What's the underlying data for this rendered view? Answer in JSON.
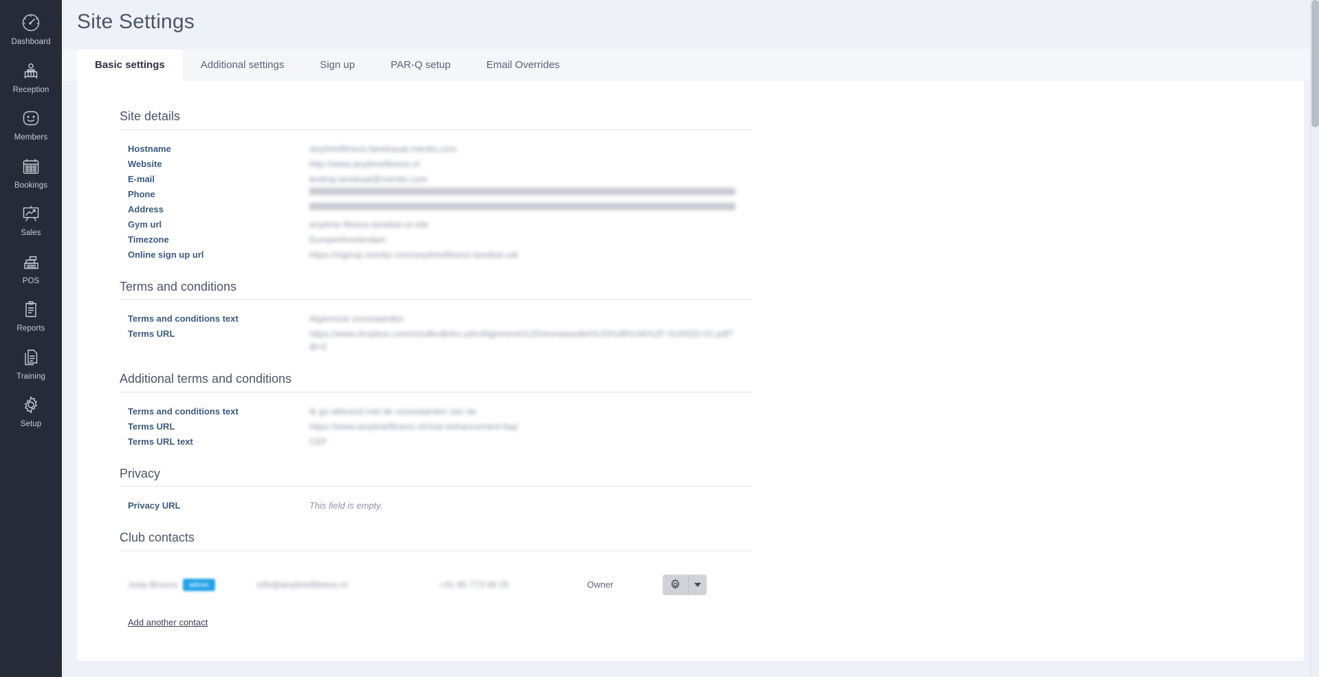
{
  "sidebar": {
    "items": [
      {
        "label": "Dashboard",
        "icon": "speedometer-icon"
      },
      {
        "label": "Reception",
        "icon": "reception-desk-icon"
      },
      {
        "label": "Members",
        "icon": "smiley-face-icon"
      },
      {
        "label": "Bookings",
        "icon": "calendar-icon"
      },
      {
        "label": "Sales",
        "icon": "presentation-chart-icon"
      },
      {
        "label": "POS",
        "icon": "cash-register-icon"
      },
      {
        "label": "Reports",
        "icon": "clipboard-icon"
      },
      {
        "label": "Training",
        "icon": "documents-icon"
      },
      {
        "label": "Setup",
        "icon": "gear-icon"
      }
    ]
  },
  "header": {
    "title": "Site Settings"
  },
  "tabs": [
    {
      "label": "Basic settings",
      "active": true
    },
    {
      "label": "Additional settings",
      "active": false
    },
    {
      "label": "Sign up",
      "active": false
    },
    {
      "label": "PAR-Q setup",
      "active": false
    },
    {
      "label": "Email Overrides",
      "active": false
    }
  ],
  "sections": {
    "site_details": {
      "title": "Site details",
      "rows": [
        {
          "label": "Hostname",
          "value": "anytimefitness-lanekauat.mentio.com",
          "redacted": true
        },
        {
          "label": "Website",
          "value": "http://www.anytimefitness.nl",
          "redacted": true
        },
        {
          "label": "E-mail",
          "value": "testing-lanekaal@mentio.com",
          "redacted": true
        },
        {
          "label": "Phone",
          "value": "0000000000000",
          "redacted": true
        },
        {
          "label": "Address",
          "value": "000000000",
          "redacted": true
        },
        {
          "label": "Gym url",
          "value": "anytime-fitness-lanekat-ut-site",
          "redacted": true
        },
        {
          "label": "Timezone",
          "value": "Europe/Amsterdam",
          "redacted": true
        },
        {
          "label": "Online sign up url",
          "value": "https://signup.mentio.com/anytimefitness-lanekat-uat",
          "redacted": true
        }
      ]
    },
    "terms": {
      "title": "Terms and conditions",
      "rows": [
        {
          "label": "Terms and conditions text",
          "value": "Algemene voorwaarden",
          "redacted": true
        },
        {
          "label": "Terms URL",
          "value": "https://www.dropbox.com/s/xulbvdkrko-ydn/Algemene%20Voorwaarden%20%38%3A%2F-%20020-02.pdf?dl=0",
          "redacted": true
        }
      ]
    },
    "additional_terms": {
      "title": "Additional terms and conditions",
      "rows": [
        {
          "label": "Terms and conditions text",
          "value": "Ik ga akkoord met de voorwaarden van de",
          "redacted": true
        },
        {
          "label": "Terms URL",
          "value": "https://www.anytimefitness.nl/club-enhancement-faq/",
          "redacted": true
        },
        {
          "label": "Terms URL text",
          "value": "CEF",
          "redacted": true
        }
      ]
    },
    "privacy": {
      "title": "Privacy",
      "rows": [
        {
          "label": "Privacy URL",
          "value": "This field is empty.",
          "redacted": false,
          "empty": true
        }
      ]
    },
    "club_contacts": {
      "title": "Club contacts",
      "contacts": [
        {
          "name": "Joep Brouns",
          "badge": "admin",
          "email": "info@anytimefitness.nl",
          "phone": "+31 85 773 99 25",
          "role": "Owner",
          "gear_icon": "gear-icon",
          "caret_icon": "chevron-down-icon"
        }
      ],
      "add_link": "Add another contact"
    }
  },
  "colors": {
    "sidebar_bg": "#262b38",
    "badge_blue": "#26a3e8",
    "title_text": "#4c5569",
    "label_blue": "#3c5a80"
  }
}
